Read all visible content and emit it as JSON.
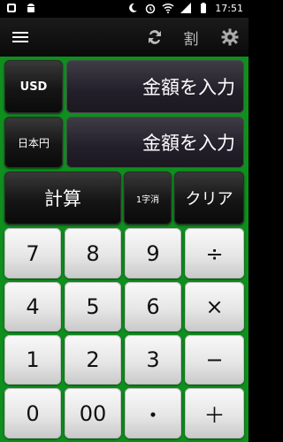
{
  "status": {
    "time": "17:51",
    "icons": [
      "moon-icon",
      "alarm-icon",
      "wifi-icon",
      "signal-icon",
      "battery-icon"
    ],
    "left_icons": [
      "notification-icon",
      "android-icon"
    ]
  },
  "toolbar": {
    "menu_icon": "menu-icon",
    "swap_icon": "swap-icon",
    "discount_label": "割",
    "settings_icon": "gear-icon"
  },
  "currency": {
    "from_code": "USD",
    "from_placeholder": "金額を入力",
    "to_code": "日本円",
    "to_placeholder": "金額を入力"
  },
  "actions": {
    "calculate": "計算",
    "delete_one": "1字消",
    "clear": "クリア"
  },
  "keypad": {
    "rows": [
      [
        "7",
        "8",
        "9",
        "÷"
      ],
      [
        "4",
        "5",
        "6",
        "×"
      ],
      [
        "1",
        "2",
        "3",
        "−"
      ],
      [
        "0",
        "00",
        "・",
        "＋"
      ]
    ]
  },
  "colors": {
    "background": "#0f8f1e",
    "accent": "#1aa22e"
  }
}
